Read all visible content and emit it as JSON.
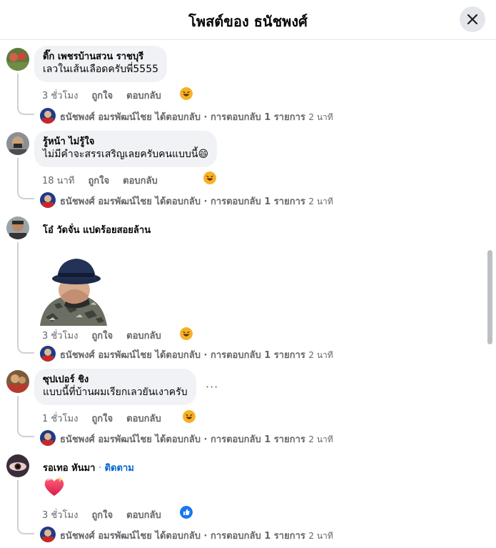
{
  "header": {
    "title": "โพสต์ของ ธนัชพงศ์"
  },
  "comments": [
    {
      "name": "ติ๊ก เพชรบ้านสวน ราชบุรี",
      "text": "เลวในเส้นเลือดครับพี่5555",
      "time": "3 ชั่วโมง",
      "like": "ถูกใจ",
      "reply": "ตอบกลับ",
      "reaction": "haha",
      "reply_summary": "ธนัชพงศ์ อมรพัฒน์ไชย ได้ตอบกลับ · การตอบกลับ 1 รายการ",
      "reply_time": "2 นาที"
    },
    {
      "name": "รู้หน้า ไม่รู้ใจ",
      "text": "ไม่มีคำจะสรรเสริญเลยครับคนแบบนี้😄",
      "time": "18 นาที",
      "like": "ถูกใจ",
      "reply": "ตอบกลับ",
      "reaction": "haha",
      "reply_summary": "ธนัชพงศ์ อมรพัฒน์ไชย ได้ตอบกลับ · การตอบกลับ 1 รายการ",
      "reply_time": "2 นาที"
    },
    {
      "name": "โอ๋ วัดจั่น แปดร้อยสอยล้าน",
      "text": "",
      "time": "3 ชั่วโมง",
      "like": "ถูกใจ",
      "reply": "ตอบกลับ",
      "reaction": "haha",
      "reply_summary": "ธนัชพงศ์ อมรพัฒน์ไชย ได้ตอบกลับ · การตอบกลับ 1 รายการ",
      "reply_time": "2 นาที"
    },
    {
      "name": "ซุปเปอร์ ชิง",
      "text": "แบบนี้ที่บ้านผมเรียกเลวยันเงาครับ",
      "time": "1 ชั่วโมง",
      "like": "ถูกใจ",
      "reply": "ตอบกลับ",
      "reaction": "haha",
      "more": "···",
      "reply_summary": "ธนัชพงศ์ อมรพัฒน์ไชย ได้ตอบกลับ · การตอบกลับ 1 รายการ",
      "reply_time": "2 นาที"
    },
    {
      "name": "รอเทอ หันมา",
      "follow": "ติดตาม",
      "separator": "·",
      "text": "",
      "time": "3 ชั่วโมง",
      "like": "ถูกใจ",
      "reply": "ตอบกลับ",
      "reaction": "like",
      "reply_summary": "ธนัชพงศ์ อมรพัฒน์ไชย ได้ตอบกลับ · การตอบกลับ 1 รายการ",
      "reply_time": "2 นาที"
    }
  ],
  "colors": {
    "secondary_text": "#65676b",
    "bubble_bg": "#f0f2f5",
    "link_blue": "#0064d1",
    "like_blue": "#1877f2",
    "haha_yellow": "#f7b125"
  }
}
